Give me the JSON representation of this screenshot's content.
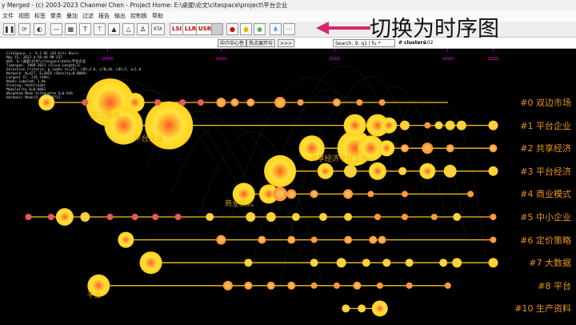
{
  "window": {
    "title": "y Merged - (c) 2003-2023 Chaomei Chen - Project Home: E:\\桌面\\论文\\citespace\\project\\平台企业"
  },
  "menu": [
    "文件",
    "视图",
    "标签",
    "聚类",
    "叠加",
    "过滤",
    "报告",
    "输出",
    "控制板",
    "帮助"
  ],
  "toolbar": {
    "buttons": [
      "pause",
      "refresh",
      "circle",
      "target",
      "line",
      "grid",
      "text",
      "icon",
      "tree",
      "triangle",
      "split",
      "kta"
    ],
    "lsi": "LSI",
    "llr": "LLR",
    "usr": "USR",
    "extra": [
      "view-a",
      "view-b",
      "view-c",
      "view-d",
      "timeline",
      "timezone",
      "gray"
    ]
  },
  "annotation": "切换为时序图",
  "subbar": {
    "btn1": "中介中心性",
    "btn2": "热点展开与",
    "btn3": ">>>",
    "search_value": "Search: 9; q1 | fu *",
    "clusters_label": "# clusters",
    "clusters_value": "102"
  },
  "info": [
    "CiteSpace, v. 6.2.R2 (64-bit) Basic",
    "May 15, 2023 4:50:49 PM CST",
    "WoS: E:\\桌面\\论文\\citespace\\data\\平台企业",
    "Timespan: 1998-2023 (Slice Length=1)",
    "Selection Criteria: g-index (k=25), LRF=3.0, L/N=10, LBY=5, e=1.0",
    "Network: N=427, E=2026 (Density=0.0089)",
    "Largest CC: 226 (94%)",
    "Nodes Labeled: 1.0%",
    "Pruning: Pathfinder",
    "Modularity Q=0.8061",
    "Weighted Mean Silhouette S=0.936",
    "Harmonic Mean(Q, S)=0.8713"
  ],
  "timeline": {
    "years": [
      "2005",
      "2010",
      "2015",
      "2020",
      "2022"
    ],
    "year_values": [
      2005,
      2010,
      2015,
      2020,
      2022
    ],
    "x_range": [
      2000,
      2024
    ]
  },
  "clusters": [
    {
      "label": "#0 双边市场",
      "end": 2020
    },
    {
      "label": "#1 平台企业",
      "end": 2022
    },
    {
      "label": "#2 共享经济",
      "end": 2022
    },
    {
      "label": "#3 平台经济",
      "end": 2022
    },
    {
      "label": "#4 商业模式",
      "end": 2021
    },
    {
      "label": "#5 中小企业",
      "end": 2022
    },
    {
      "label": "#6 定价策略",
      "end": 2022
    },
    {
      "label": "#7 大数据",
      "end": 2022
    },
    {
      "label": "#8 平台",
      "end": 2020
    },
    {
      "label": "#10 生产资料",
      "end": 2017
    }
  ],
  "nodes": [
    [
      2002.3,
      0,
      10
    ],
    [
      2004,
      0,
      4
    ],
    [
      2005.1,
      0,
      30
    ],
    [
      2006.2,
      0,
      12
    ],
    [
      2007.2,
      0,
      4
    ],
    [
      2008.3,
      0,
      4
    ],
    [
      2009.1,
      0,
      4
    ],
    [
      2010,
      0,
      6
    ],
    [
      2010.6,
      0,
      5
    ],
    [
      2011.3,
      0,
      5
    ],
    [
      2012.6,
      0,
      7
    ],
    [
      2013.5,
      0,
      4
    ],
    [
      2015.1,
      0,
      5
    ],
    [
      2016.1,
      0,
      4
    ],
    [
      2017.1,
      0,
      4
    ],
    [
      2005.7,
      1,
      24
    ],
    [
      2007.7,
      1,
      30
    ],
    [
      2015.9,
      1,
      14
    ],
    [
      2016.9,
      1,
      14
    ],
    [
      2017.4,
      1,
      10
    ],
    [
      2018.1,
      1,
      6
    ],
    [
      2019.1,
      1,
      4
    ],
    [
      2019.6,
      1,
      5
    ],
    [
      2020.1,
      1,
      6
    ],
    [
      2020.6,
      1,
      6
    ],
    [
      2022,
      1,
      6
    ],
    [
      2014,
      2,
      16
    ],
    [
      2015.9,
      2,
      22
    ],
    [
      2016.6,
      2,
      16
    ],
    [
      2017.3,
      2,
      10
    ],
    [
      2018.1,
      2,
      5
    ],
    [
      2019.1,
      2,
      7
    ],
    [
      2020.1,
      2,
      5
    ],
    [
      2022,
      2,
      5
    ],
    [
      2012.6,
      3,
      20
    ],
    [
      2014.6,
      3,
      10
    ],
    [
      2015.7,
      3,
      8
    ],
    [
      2016.9,
      3,
      11
    ],
    [
      2018,
      3,
      5
    ],
    [
      2019.1,
      3,
      10
    ],
    [
      2020.1,
      3,
      8
    ],
    [
      2022,
      3,
      6
    ],
    [
      2011,
      4,
      14
    ],
    [
      2012.1,
      4,
      12
    ],
    [
      2012.6,
      4,
      9
    ],
    [
      2013.1,
      4,
      6
    ],
    [
      2014.1,
      4,
      5
    ],
    [
      2015.6,
      4,
      6
    ],
    [
      2016.6,
      4,
      4
    ],
    [
      2018.1,
      4,
      4
    ],
    [
      2021,
      4,
      4
    ],
    [
      2001.5,
      5,
      4
    ],
    [
      2002.5,
      5,
      4
    ],
    [
      2003.1,
      5,
      11
    ],
    [
      2004,
      5,
      6
    ],
    [
      2005.1,
      5,
      4
    ],
    [
      2006.2,
      5,
      4
    ],
    [
      2007.1,
      5,
      4
    ],
    [
      2008.1,
      5,
      4
    ],
    [
      2009.5,
      5,
      5
    ],
    [
      2011.3,
      5,
      6
    ],
    [
      2012.2,
      5,
      6
    ],
    [
      2013.3,
      5,
      5
    ],
    [
      2014.5,
      5,
      5
    ],
    [
      2015.6,
      5,
      5
    ],
    [
      2016.9,
      5,
      4
    ],
    [
      2018.1,
      5,
      4
    ],
    [
      2019.4,
      5,
      4
    ],
    [
      2020.4,
      5,
      5
    ],
    [
      2022,
      5,
      4
    ],
    [
      2005.8,
      6,
      10
    ],
    [
      2010,
      6,
      6
    ],
    [
      2011.8,
      6,
      5
    ],
    [
      2013.1,
      6,
      5
    ],
    [
      2014.1,
      6,
      4
    ],
    [
      2015.6,
      6,
      5
    ],
    [
      2016.7,
      6,
      5
    ],
    [
      2017.1,
      6,
      5
    ],
    [
      2022,
      6,
      4
    ],
    [
      2006.9,
      7,
      14
    ],
    [
      2011.2,
      7,
      5
    ],
    [
      2014.1,
      7,
      5
    ],
    [
      2015.3,
      7,
      6
    ],
    [
      2016.4,
      7,
      5
    ],
    [
      2017.3,
      7,
      5
    ],
    [
      2018.3,
      7,
      5
    ],
    [
      2019.8,
      7,
      5
    ],
    [
      2020.4,
      7,
      6
    ],
    [
      2022,
      7,
      6
    ],
    [
      2004.6,
      8,
      14
    ],
    [
      2010.3,
      8,
      6
    ],
    [
      2011.2,
      8,
      5
    ],
    [
      2012.2,
      8,
      5
    ],
    [
      2013.1,
      8,
      5
    ],
    [
      2014.1,
      8,
      4
    ],
    [
      2015.1,
      8,
      4
    ],
    [
      2016,
      8,
      5
    ],
    [
      2017,
      8,
      4
    ],
    [
      2018.3,
      8,
      4
    ],
    [
      2020,
      8,
      4
    ],
    [
      2015.5,
      9,
      5
    ],
    [
      2016.2,
      9,
      5
    ],
    [
      2017,
      9,
      10
    ]
  ],
  "node_labels": [
    {
      "text": "双边市场",
      "x": 2004.9,
      "c": 0,
      "dy": 1.3
    },
    {
      "text": "平台企业",
      "x": 2006.8,
      "c": 1,
      "dy": 1.3
    },
    {
      "text": "共享经济平台企业",
      "x": 2015.2,
      "c": 2,
      "dy": 1.0
    },
    {
      "text": "商业模式",
      "x": 2010.8,
      "c": 4,
      "dy": 0.9
    },
    {
      "text": "平台",
      "x": 2004.4,
      "c": 8,
      "dy": 0.9
    }
  ],
  "colors": {
    "line": "#f5c518",
    "label": "#e8931d",
    "year": "#ff00ff",
    "canvas": "#000000"
  }
}
